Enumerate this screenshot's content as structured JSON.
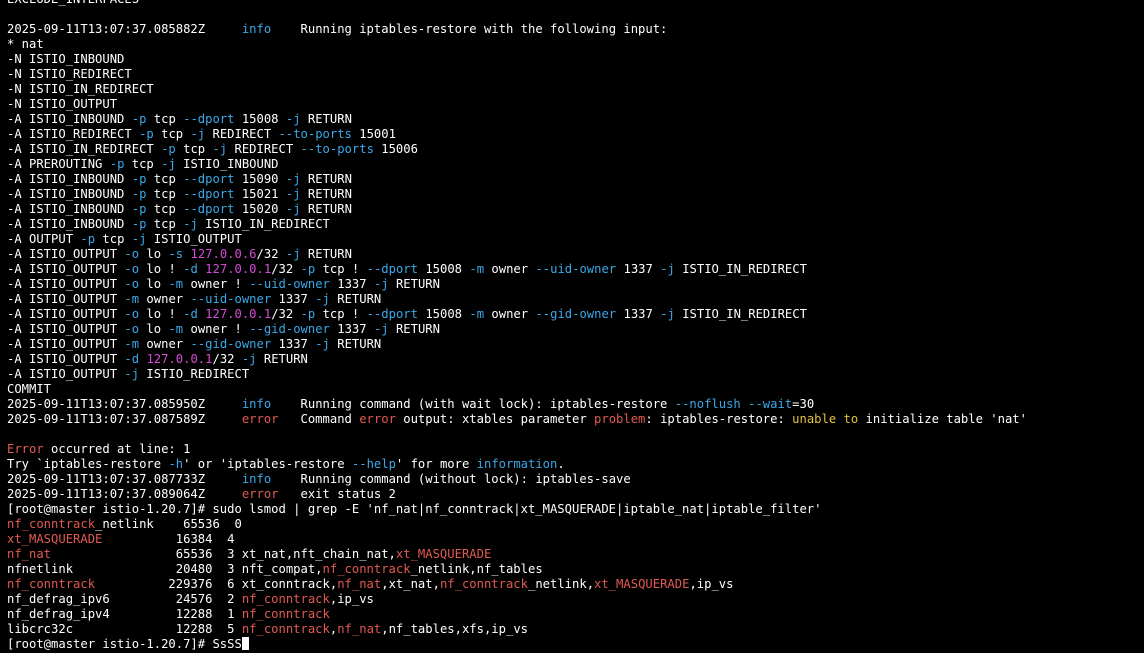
{
  "terminal": {
    "colors": {
      "default": "#ffffff",
      "info": "#3aa8e8",
      "option": "#3aa8e8",
      "ip": "#d44cd4",
      "error": "#e05a52",
      "warn": "#e0c040",
      "match": "#e05a52",
      "background": "#000000"
    },
    "lines": [
      [
        {
          "t": "EXCLUDE_INTERFACES"
        }
      ],
      [],
      [
        {
          "t": "2025-09-11T13:07:37.085882Z     "
        },
        {
          "t": "info",
          "c": "info"
        },
        {
          "t": "    Running iptables-restore with the following input:"
        }
      ],
      [
        {
          "t": "* nat"
        }
      ],
      [
        {
          "t": "-N ISTIO_INBOUND"
        }
      ],
      [
        {
          "t": "-N ISTIO_REDIRECT"
        }
      ],
      [
        {
          "t": "-N ISTIO_IN_REDIRECT"
        }
      ],
      [
        {
          "t": "-N ISTIO_OUTPUT"
        }
      ],
      [
        {
          "t": "-A ISTIO_INBOUND "
        },
        {
          "t": "-p",
          "c": "option"
        },
        {
          "t": " tcp "
        },
        {
          "t": "--dport",
          "c": "option"
        },
        {
          "t": " 15008 "
        },
        {
          "t": "-j",
          "c": "option"
        },
        {
          "t": " RETURN"
        }
      ],
      [
        {
          "t": "-A ISTIO_REDIRECT "
        },
        {
          "t": "-p",
          "c": "option"
        },
        {
          "t": " tcp "
        },
        {
          "t": "-j",
          "c": "option"
        },
        {
          "t": " REDIRECT "
        },
        {
          "t": "--to-ports",
          "c": "option"
        },
        {
          "t": " 15001"
        }
      ],
      [
        {
          "t": "-A ISTIO_IN_REDIRECT "
        },
        {
          "t": "-p",
          "c": "option"
        },
        {
          "t": " tcp "
        },
        {
          "t": "-j",
          "c": "option"
        },
        {
          "t": " REDIRECT "
        },
        {
          "t": "--to-ports",
          "c": "option"
        },
        {
          "t": " 15006"
        }
      ],
      [
        {
          "t": "-A PREROUTING "
        },
        {
          "t": "-p",
          "c": "option"
        },
        {
          "t": " tcp "
        },
        {
          "t": "-j",
          "c": "option"
        },
        {
          "t": " ISTIO_INBOUND"
        }
      ],
      [
        {
          "t": "-A ISTIO_INBOUND "
        },
        {
          "t": "-p",
          "c": "option"
        },
        {
          "t": " tcp "
        },
        {
          "t": "--dport",
          "c": "option"
        },
        {
          "t": " 15090 "
        },
        {
          "t": "-j",
          "c": "option"
        },
        {
          "t": " RETURN"
        }
      ],
      [
        {
          "t": "-A ISTIO_INBOUND "
        },
        {
          "t": "-p",
          "c": "option"
        },
        {
          "t": " tcp "
        },
        {
          "t": "--dport",
          "c": "option"
        },
        {
          "t": " 15021 "
        },
        {
          "t": "-j",
          "c": "option"
        },
        {
          "t": " RETURN"
        }
      ],
      [
        {
          "t": "-A ISTIO_INBOUND "
        },
        {
          "t": "-p",
          "c": "option"
        },
        {
          "t": " tcp "
        },
        {
          "t": "--dport",
          "c": "option"
        },
        {
          "t": " 15020 "
        },
        {
          "t": "-j",
          "c": "option"
        },
        {
          "t": " RETURN"
        }
      ],
      [
        {
          "t": "-A ISTIO_INBOUND "
        },
        {
          "t": "-p",
          "c": "option"
        },
        {
          "t": " tcp "
        },
        {
          "t": "-j",
          "c": "option"
        },
        {
          "t": " ISTIO_IN_REDIRECT"
        }
      ],
      [
        {
          "t": "-A OUTPUT "
        },
        {
          "t": "-p",
          "c": "option"
        },
        {
          "t": " tcp "
        },
        {
          "t": "-j",
          "c": "option"
        },
        {
          "t": " ISTIO_OUTPUT"
        }
      ],
      [
        {
          "t": "-A ISTIO_OUTPUT "
        },
        {
          "t": "-o",
          "c": "option"
        },
        {
          "t": " lo "
        },
        {
          "t": "-s",
          "c": "option"
        },
        {
          "t": " "
        },
        {
          "t": "127.0.0.6",
          "c": "ip"
        },
        {
          "t": "/32 "
        },
        {
          "t": "-j",
          "c": "option"
        },
        {
          "t": " RETURN"
        }
      ],
      [
        {
          "t": "-A ISTIO_OUTPUT "
        },
        {
          "t": "-o",
          "c": "option"
        },
        {
          "t": " lo ! "
        },
        {
          "t": "-d",
          "c": "option"
        },
        {
          "t": " "
        },
        {
          "t": "127.0.0.1",
          "c": "ip"
        },
        {
          "t": "/32 "
        },
        {
          "t": "-p",
          "c": "option"
        },
        {
          "t": " tcp ! "
        },
        {
          "t": "--dport",
          "c": "option"
        },
        {
          "t": " 15008 "
        },
        {
          "t": "-m",
          "c": "option"
        },
        {
          "t": " owner "
        },
        {
          "t": "--uid-owner",
          "c": "option"
        },
        {
          "t": " 1337 "
        },
        {
          "t": "-j",
          "c": "option"
        },
        {
          "t": " ISTIO_IN_REDIRECT"
        }
      ],
      [
        {
          "t": "-A ISTIO_OUTPUT "
        },
        {
          "t": "-o",
          "c": "option"
        },
        {
          "t": " lo "
        },
        {
          "t": "-m",
          "c": "option"
        },
        {
          "t": " owner ! "
        },
        {
          "t": "--uid-owner",
          "c": "option"
        },
        {
          "t": " 1337 "
        },
        {
          "t": "-j",
          "c": "option"
        },
        {
          "t": " RETURN"
        }
      ],
      [
        {
          "t": "-A ISTIO_OUTPUT "
        },
        {
          "t": "-m",
          "c": "option"
        },
        {
          "t": " owner "
        },
        {
          "t": "--uid-owner",
          "c": "option"
        },
        {
          "t": " 1337 "
        },
        {
          "t": "-j",
          "c": "option"
        },
        {
          "t": " RETURN"
        }
      ],
      [
        {
          "t": "-A ISTIO_OUTPUT "
        },
        {
          "t": "-o",
          "c": "option"
        },
        {
          "t": " lo ! "
        },
        {
          "t": "-d",
          "c": "option"
        },
        {
          "t": " "
        },
        {
          "t": "127.0.0.1",
          "c": "ip"
        },
        {
          "t": "/32 "
        },
        {
          "t": "-p",
          "c": "option"
        },
        {
          "t": " tcp ! "
        },
        {
          "t": "--dport",
          "c": "option"
        },
        {
          "t": " 15008 "
        },
        {
          "t": "-m",
          "c": "option"
        },
        {
          "t": " owner "
        },
        {
          "t": "--gid-owner",
          "c": "option"
        },
        {
          "t": " 1337 "
        },
        {
          "t": "-j",
          "c": "option"
        },
        {
          "t": " ISTIO_IN_REDIRECT"
        }
      ],
      [
        {
          "t": "-A ISTIO_OUTPUT "
        },
        {
          "t": "-o",
          "c": "option"
        },
        {
          "t": " lo "
        },
        {
          "t": "-m",
          "c": "option"
        },
        {
          "t": " owner ! "
        },
        {
          "t": "--gid-owner",
          "c": "option"
        },
        {
          "t": " 1337 "
        },
        {
          "t": "-j",
          "c": "option"
        },
        {
          "t": " RETURN"
        }
      ],
      [
        {
          "t": "-A ISTIO_OUTPUT "
        },
        {
          "t": "-m",
          "c": "option"
        },
        {
          "t": " owner "
        },
        {
          "t": "--gid-owner",
          "c": "option"
        },
        {
          "t": " 1337 "
        },
        {
          "t": "-j",
          "c": "option"
        },
        {
          "t": " RETURN"
        }
      ],
      [
        {
          "t": "-A ISTIO_OUTPUT "
        },
        {
          "t": "-d",
          "c": "option"
        },
        {
          "t": " "
        },
        {
          "t": "127.0.0.1",
          "c": "ip"
        },
        {
          "t": "/32 "
        },
        {
          "t": "-j",
          "c": "option"
        },
        {
          "t": " RETURN"
        }
      ],
      [
        {
          "t": "-A ISTIO_OUTPUT "
        },
        {
          "t": "-j",
          "c": "option"
        },
        {
          "t": " ISTIO_REDIRECT"
        }
      ],
      [
        {
          "t": "COMMIT"
        }
      ],
      [
        {
          "t": "2025-09-11T13:07:37.085950Z     "
        },
        {
          "t": "info",
          "c": "info"
        },
        {
          "t": "    Running command (with wait lock): iptables-restore "
        },
        {
          "t": "--noflush",
          "c": "option"
        },
        {
          "t": " "
        },
        {
          "t": "--wait",
          "c": "option"
        },
        {
          "t": "=30"
        }
      ],
      [
        {
          "t": "2025-09-11T13:07:37.087589Z     "
        },
        {
          "t": "error",
          "c": "error"
        },
        {
          "t": "   Command "
        },
        {
          "t": "error",
          "c": "error"
        },
        {
          "t": " output: xtables parameter "
        },
        {
          "t": "problem",
          "c": "error"
        },
        {
          "t": ": iptables-restore: "
        },
        {
          "t": "unable to",
          "c": "warn"
        },
        {
          "t": " initialize table 'nat'"
        }
      ],
      [],
      [
        {
          "t": "Error",
          "c": "error"
        },
        {
          "t": " occurred at line: 1"
        }
      ],
      [
        {
          "t": "Try `iptables-restore "
        },
        {
          "t": "-h",
          "c": "option"
        },
        {
          "t": "' or 'iptables-restore "
        },
        {
          "t": "--help",
          "c": "option"
        },
        {
          "t": "' for more "
        },
        {
          "t": "information",
          "c": "info"
        },
        {
          "t": "."
        }
      ],
      [
        {
          "t": "2025-09-11T13:07:37.087733Z     "
        },
        {
          "t": "info",
          "c": "info"
        },
        {
          "t": "    Running command (without lock): iptables-save"
        }
      ],
      [
        {
          "t": "2025-09-11T13:07:37.089064Z     "
        },
        {
          "t": "error",
          "c": "error"
        },
        {
          "t": "   exit status 2"
        }
      ],
      [
        {
          "t": "[root@master istio-1.20.7]# sudo lsmod | grep -E 'nf_nat|nf_conntrack|xt_MASQUERADE|iptable_nat|iptable_filter'"
        }
      ],
      [
        {
          "t": "nf_conntrack",
          "c": "match"
        },
        {
          "t": "_netlink    65536  0"
        }
      ],
      [
        {
          "t": "xt_MASQUERADE",
          "c": "match"
        },
        {
          "t": "          16384  4"
        }
      ],
      [
        {
          "t": "nf_nat",
          "c": "match"
        },
        {
          "t": "                 65536  3 xt_nat,nft_chain_nat,"
        },
        {
          "t": "xt_MASQUERADE",
          "c": "match"
        }
      ],
      [
        {
          "t": "nfnetlink              20480  3 nft_compat,"
        },
        {
          "t": "nf_conntrack",
          "c": "match"
        },
        {
          "t": "_netlink,nf_tables"
        }
      ],
      [
        {
          "t": "nf_conntrack",
          "c": "match"
        },
        {
          "t": "          229376  6 xt_conntrack,"
        },
        {
          "t": "nf_nat",
          "c": "match"
        },
        {
          "t": ",xt_nat,"
        },
        {
          "t": "nf_conntrack",
          "c": "match"
        },
        {
          "t": "_netlink,"
        },
        {
          "t": "xt_MASQUERADE",
          "c": "match"
        },
        {
          "t": ",ip_vs"
        }
      ],
      [
        {
          "t": "nf_defrag_ipv6         24576  2 "
        },
        {
          "t": "nf_conntrack",
          "c": "match"
        },
        {
          "t": ",ip_vs"
        }
      ],
      [
        {
          "t": "nf_defrag_ipv4         12288  1 "
        },
        {
          "t": "nf_conntrack",
          "c": "match"
        }
      ],
      [
        {
          "t": "libcrc32c              12288  5 "
        },
        {
          "t": "nf_conntrack",
          "c": "match"
        },
        {
          "t": ","
        },
        {
          "t": "nf_nat",
          "c": "match"
        },
        {
          "t": ",nf_tables,xfs,ip_vs"
        }
      ],
      [
        {
          "t": "[root@master istio-1.20.7]# SsSS"
        },
        {
          "cursor": true
        }
      ]
    ]
  }
}
